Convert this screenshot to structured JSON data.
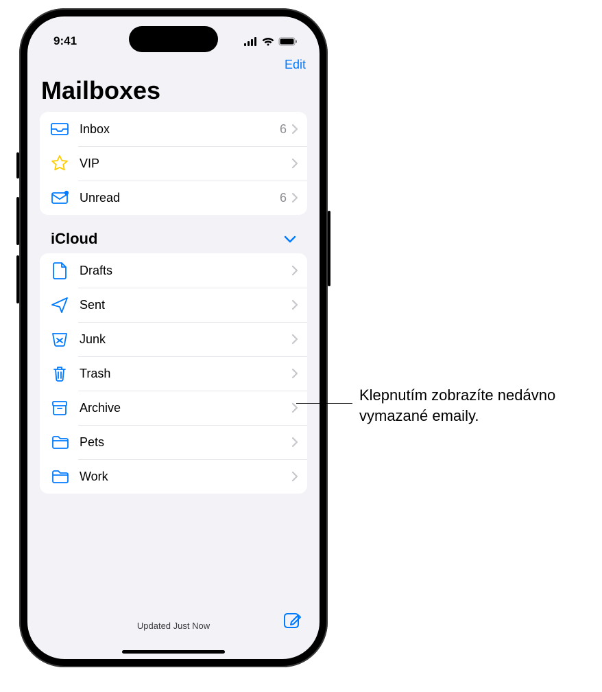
{
  "status": {
    "time": "9:41"
  },
  "nav": {
    "edit": "Edit"
  },
  "title": "Mailboxes",
  "topGroup": [
    {
      "icon": "inbox",
      "label": "Inbox",
      "count": "6"
    },
    {
      "icon": "vip",
      "label": "VIP",
      "count": ""
    },
    {
      "icon": "unread",
      "label": "Unread",
      "count": "6"
    }
  ],
  "sectionHeader": "iCloud",
  "icloudGroup": [
    {
      "icon": "drafts",
      "label": "Drafts"
    },
    {
      "icon": "sent",
      "label": "Sent"
    },
    {
      "icon": "junk",
      "label": "Junk"
    },
    {
      "icon": "trash",
      "label": "Trash"
    },
    {
      "icon": "archive",
      "label": "Archive"
    },
    {
      "icon": "folder",
      "label": "Pets"
    },
    {
      "icon": "folder",
      "label": "Work"
    }
  ],
  "toolbar": {
    "status": "Updated Just Now"
  },
  "callout": "Klepnutím zobrazíte nedávno vymazané emaily."
}
